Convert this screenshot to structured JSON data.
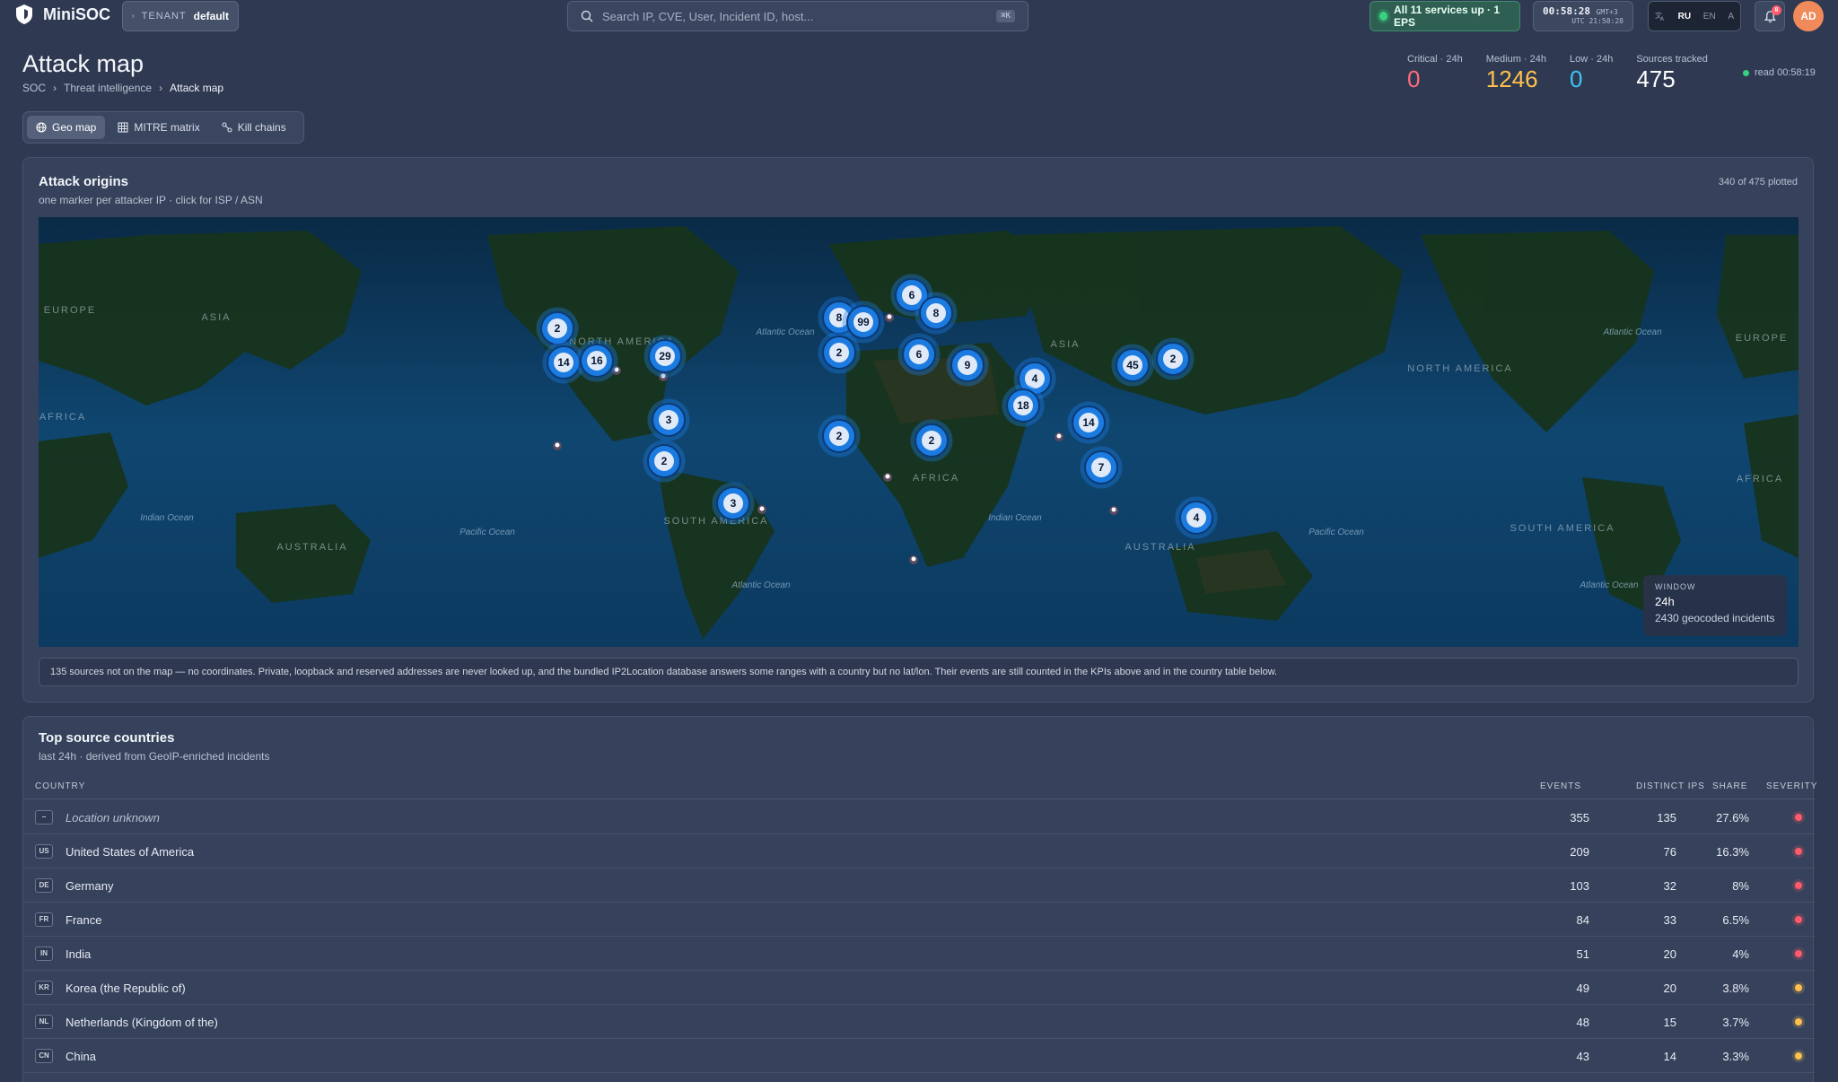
{
  "app": {
    "name": "MiniSOC"
  },
  "tenant": {
    "label": "TENANT",
    "value": "default"
  },
  "search": {
    "placeholder": "Search IP, CVE, User, Incident ID, host...",
    "shortcut": "⌘K"
  },
  "status": {
    "text": "All 11 services up · 1 EPS",
    "color": "#38d27e"
  },
  "clock": {
    "time": "00:58:28",
    "tz": "GMT+3",
    "utc": "UTC 21:58:28"
  },
  "lang": {
    "options": [
      "RU",
      "EN",
      "A"
    ],
    "active": "RU"
  },
  "notifications": {
    "count": "8"
  },
  "user": {
    "initials": "AD"
  },
  "page": {
    "title": "Attack map",
    "breadcrumb": [
      "SOC",
      "Threat intelligence",
      "Attack map"
    ]
  },
  "kpis": [
    {
      "label": "Critical · 24h",
      "value": "0",
      "color": "#ff6b7a"
    },
    {
      "label": "Medium · 24h",
      "value": "1246",
      "color": "#ffc04d"
    },
    {
      "label": "Low · 24h",
      "value": "0",
      "color": "#3fc3f0"
    },
    {
      "label": "Sources tracked",
      "value": "475",
      "color": "#ffffff"
    }
  ],
  "read": {
    "text": "read 00:58:19"
  },
  "tabs": [
    {
      "label": "Geo map",
      "icon": "globe-icon",
      "active": true
    },
    {
      "label": "MITRE matrix",
      "icon": "grid-icon",
      "active": false
    },
    {
      "label": "Kill chains",
      "icon": "chain-icon",
      "active": false
    }
  ],
  "attack_origins": {
    "title": "Attack origins",
    "subtitle": "one marker per attacker IP · click for ISP / ASN",
    "plotted": "340 of 475 plotted",
    "clusters": [
      "2",
      "14",
      "16",
      "29",
      "3",
      "2",
      "3",
      "8",
      "99",
      "6",
      "8",
      "2",
      "6",
      "9",
      "2",
      "2",
      "4",
      "18",
      "14",
      "7",
      "45",
      "2",
      "4"
    ],
    "labels": {
      "continents": [
        "EUROPE",
        "ASIA",
        "AFRICA",
        "AUSTRALIA",
        "NORTH AMERICA",
        "SOUTH AMERICA",
        "AFRICA",
        "ASIA",
        "AUSTRALIA",
        "NORTH AMERICA",
        "SOUTH AMERICA",
        "AFRICA",
        "EUROPE"
      ],
      "oceans": [
        "Indian Ocean",
        "Pacific Ocean",
        "Atlantic Ocean",
        "Atlantic Ocean",
        "Indian Ocean",
        "Pacific Ocean",
        "Atlantic Ocean",
        "Atlantic Ocean"
      ]
    },
    "window": {
      "label": "WINDOW",
      "value": "24h",
      "detail": "2430 geocoded incidents"
    },
    "notice": "135 sources not on the map — no coordinates. Private, loopback and reserved addresses are never looked up, and the bundled IP2Location database answers some ranges with a country but no lat/lon. Their events are still counted in the KPIs above and in the country table below."
  },
  "countries": {
    "title": "Top source countries",
    "subtitle": "last 24h · derived from GeoIP-enriched incidents",
    "columns": {
      "country": "COUNTRY",
      "events": "EVENTS",
      "ips": "DISTINCT IPS",
      "share": "SHARE",
      "severity": "SEVERITY"
    },
    "rows": [
      {
        "code": "–",
        "name": "Location unknown",
        "events": "355",
        "ips": "135",
        "share": "27.6%",
        "sev": "#ff5a6a"
      },
      {
        "code": "US",
        "name": "United States of America",
        "events": "209",
        "ips": "76",
        "share": "16.3%",
        "sev": "#ff5a6a"
      },
      {
        "code": "DE",
        "name": "Germany",
        "events": "103",
        "ips": "32",
        "share": "8%",
        "sev": "#ff5a6a"
      },
      {
        "code": "FR",
        "name": "France",
        "events": "84",
        "ips": "33",
        "share": "6.5%",
        "sev": "#ff5a6a"
      },
      {
        "code": "IN",
        "name": "India",
        "events": "51",
        "ips": "20",
        "share": "4%",
        "sev": "#ff5a6a"
      },
      {
        "code": "KR",
        "name": "Korea (the Republic of)",
        "events": "49",
        "ips": "20",
        "share": "3.8%",
        "sev": "#ffc04d"
      },
      {
        "code": "NL",
        "name": "Netherlands (Kingdom of the)",
        "events": "48",
        "ips": "15",
        "share": "3.7%",
        "sev": "#ffc04d"
      },
      {
        "code": "CN",
        "name": "China",
        "events": "43",
        "ips": "14",
        "share": "3.3%",
        "sev": "#ffc04d"
      }
    ]
  }
}
